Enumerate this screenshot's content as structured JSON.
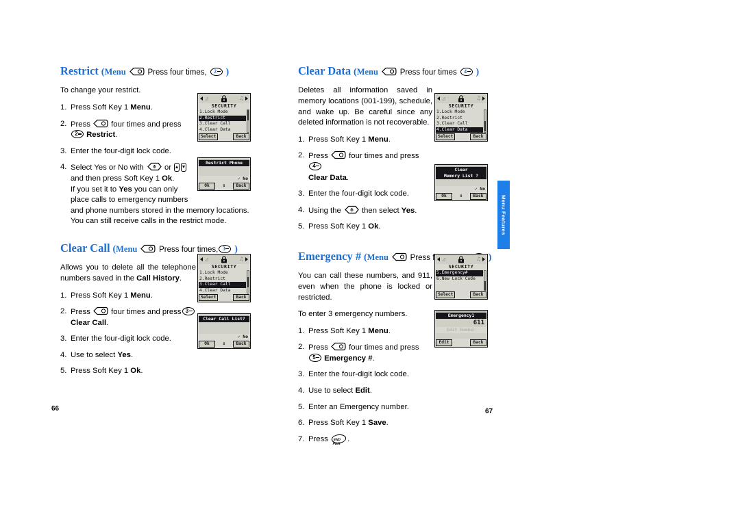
{
  "document": {
    "page_left": "66",
    "page_right": "67",
    "side_tab": "Menu Features",
    "accent_color": "#1f6fd0",
    "tab_color": "#1f7fe8"
  },
  "sections": [
    {
      "id": "restrict",
      "title": "Restrict",
      "paren_open": "(",
      "menu_word": "Menu",
      "nav_icon": "nav-key-icon",
      "press_text": "Press four times,",
      "key_digit": "2",
      "paren_close": ")",
      "intro": "To change your restrict.",
      "steps": [
        {
          "num": "1.",
          "text": "Press Soft Key 1 Menu."
        },
        {
          "num": "2.",
          "text": "Press  four times and press   Restrict."
        },
        {
          "num": "3.",
          "text": "Enter the four-digit lock code."
        },
        {
          "num": "4.",
          "text": "Select Yes or No with  or   and then press Soft Key 1 Ok. If you set it to Yes you can only place calls to emergency numbers and phone numbers stored in the memory locations. You can still receive calls in the restrict mode."
        }
      ],
      "step4_lines": {
        "l1_a": "Select Yes or No with",
        "l1_or": "or",
        "l2": "and then press Soft Key 1 ",
        "l2_b": "Ok",
        "l2_end": ".",
        "l3_a": "If you set it to ",
        "l3_b": "Yes",
        "l3_c": " you can only",
        "l4": "place calls to emergency numbers",
        "l5": "and phone numbers stored in the memory locations.",
        "l6": "You can still receive calls in the restrict mode."
      }
    },
    {
      "id": "clear-call",
      "title": "Clear Call",
      "paren_open": "(",
      "menu_word": "Menu",
      "press_text": "Press four times,",
      "key_digit": "3",
      "paren_close": ")",
      "intro_a": "Allows you to delete all the telephone numbers saved in the ",
      "intro_b": "Call History",
      "intro_c": ".",
      "steps": [
        {
          "num": "1.",
          "text": "Press Soft Key 1 Menu."
        },
        {
          "num": "2.",
          "text": "Press  four times and press   Clear Call."
        },
        {
          "num": "3.",
          "text": "Enter the four-digit lock code."
        },
        {
          "num": "4.",
          "text": "Use to select Yes."
        },
        {
          "num": "5.",
          "text": "Press Soft Key 1 Ok."
        }
      ]
    },
    {
      "id": "clear-data",
      "title": "Clear Data",
      "paren_open": "(",
      "menu_word": "Menu",
      "press_text": "Press four times",
      "key_digit": "4",
      "paren_close": ")",
      "intro": "Deletes all information saved in memory locations (001-199), schedule, and wake up. Be careful since any deleted information is not recoverable.",
      "steps": [
        {
          "num": "1.",
          "text": "Press Soft Key 1 Menu."
        },
        {
          "num": "2.",
          "text": "Press  four times and press   Clear Data."
        },
        {
          "num": "3.",
          "text": "Enter the four-digit lock code."
        },
        {
          "num": "4.",
          "text": "Using the  then select Yes."
        },
        {
          "num": "5.",
          "text": "Press Soft Key 1 Ok."
        }
      ]
    },
    {
      "id": "emergency",
      "title": "Emergency #",
      "paren_open": "(",
      "menu_word": "Menu",
      "press_text": "Press four times,",
      "key_digit": "5",
      "paren_close": ")",
      "intro": "You can call these numbers, and 911, even when the phone is locked or restricted.",
      "intro2": "To enter 3 emergency numbers.",
      "steps": [
        {
          "num": "1.",
          "text": "Press Soft Key 1 Menu."
        },
        {
          "num": "2.",
          "text": "Press  four times and press   Emergency #."
        },
        {
          "num": "3.",
          "text": "Enter the four-digit lock code."
        },
        {
          "num": "4.",
          "text": "Use to select Edit."
        },
        {
          "num": "5.",
          "text": "Enter an Emergency number."
        },
        {
          "num": "6.",
          "text": "Press Soft Key 1 Save."
        },
        {
          "num": "7.",
          "text": "Press ."
        }
      ]
    }
  ],
  "labels": {
    "press_word": "Press",
    "press_soft_key_1": "Press Soft Key 1",
    "menu_bold": "Menu",
    "four_times_and_press": "four times and press",
    "enter_lock_code": "Enter the four-digit lock code.",
    "ok_bold": "Ok",
    "yes_bold": "Yes",
    "no_word": "No",
    "use_to_select": "Use to select",
    "edit_bold": "Edit",
    "save_bold": "Save",
    "using_the": "Using the",
    "then_select": "then select",
    "period": ".",
    "or_word": "or",
    "select_yes_or_no_with": "Select Yes or No with",
    "enter_emergency_number": "Enter an Emergency number.",
    "to_enter_3": "To enter 3 emergency numbers.",
    "restrict_bold": "Restrict",
    "clear_call_bold": "Clear Call",
    "clear_data_bold": "Clear Data",
    "emergency_bold": "Emergency #"
  },
  "screens": {
    "security_restrict": {
      "title": "SECURITY",
      "items": [
        {
          "label": "1.Lock Mode",
          "selected": false
        },
        {
          "label": "2.Restrict",
          "selected": true
        },
        {
          "label": "3.Clear Call",
          "selected": false
        },
        {
          "label": "4.Clear Data",
          "selected": false
        }
      ],
      "soft_left": "Select",
      "soft_right": "Back",
      "scroll_pos": "top"
    },
    "restrict_phone": {
      "banner": "Restrict Phone",
      "check": "✓",
      "value": "No",
      "soft_left": "Ok",
      "soft_mid": "↕",
      "soft_right": "Back"
    },
    "security_clear_call": {
      "title": "SECURITY",
      "items": [
        {
          "label": "1.Lock Mode",
          "selected": false
        },
        {
          "label": "2.Restrict",
          "selected": false
        },
        {
          "label": "3.Clear Call",
          "selected": true
        },
        {
          "label": "4.Clear Data",
          "selected": false
        }
      ],
      "soft_left": "Select",
      "soft_right": "Back",
      "scroll_pos": "mid"
    },
    "clear_call_list": {
      "banner": "Clear Call List?",
      "check": "✓",
      "value": "No",
      "soft_left": "Ok",
      "soft_mid": "↕",
      "soft_right": "Back"
    },
    "security_clear_data": {
      "title": "SECURITY",
      "items": [
        {
          "label": "1.Lock Mode",
          "selected": false
        },
        {
          "label": "2.Restrict",
          "selected": false
        },
        {
          "label": "3.Clear Call",
          "selected": false
        },
        {
          "label": "4.Clear Data",
          "selected": true
        }
      ],
      "soft_left": "Select",
      "soft_right": "Back",
      "scroll_pos": "bottom"
    },
    "clear_memory_list": {
      "banner_l1": "Clear",
      "banner_l2": "Memory List ?",
      "check": "✓",
      "value": "No",
      "soft_left": "Ok",
      "soft_mid": "↕",
      "soft_right": "Back"
    },
    "security_emergency": {
      "title": "SECURITY",
      "items": [
        {
          "label": "5.Emergency#",
          "selected": true
        },
        {
          "label": "6.New Lock Code",
          "selected": false
        }
      ],
      "soft_left": "Select",
      "soft_right": "Back",
      "scroll_pos": "bottom"
    },
    "emergency1": {
      "banner": "Emergency1",
      "value": "611",
      "ghost": "Edit Number",
      "soft_left": "Edit",
      "soft_right": "Back"
    }
  }
}
